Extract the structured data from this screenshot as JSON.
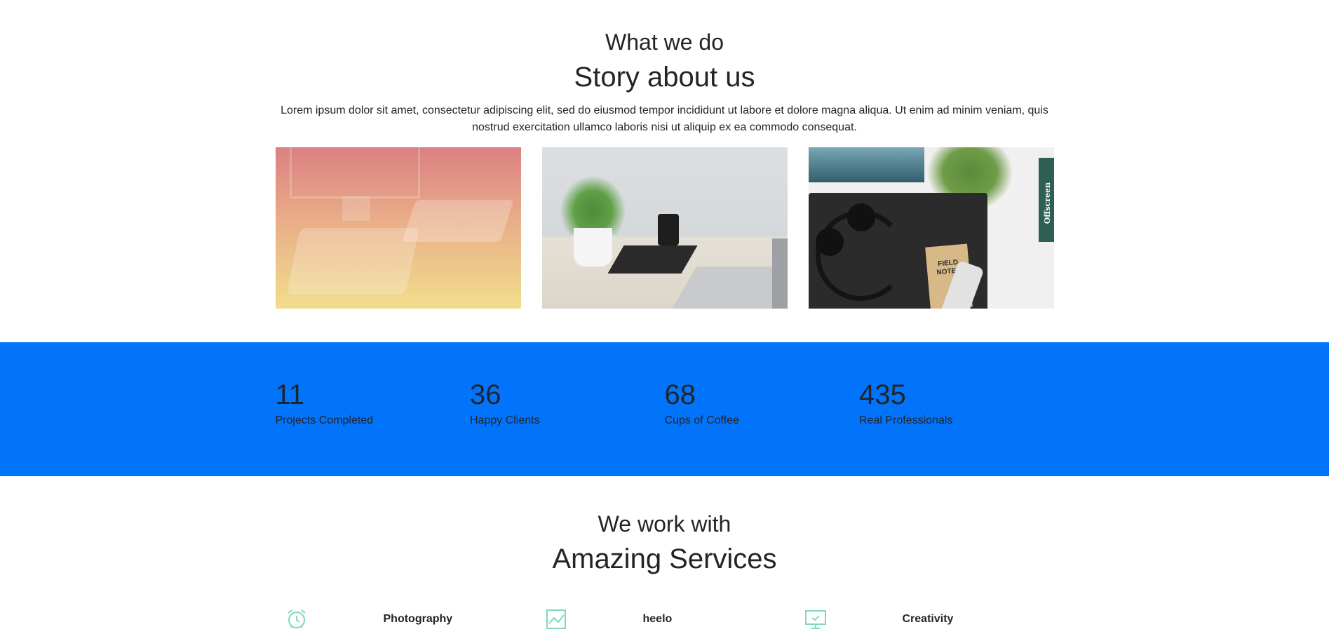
{
  "story": {
    "kicker": "What we do",
    "title": "Story about us",
    "lead": "Lorem ipsum dolor sit amet, consectetur adipiscing elit, sed do eiusmod tempor incididunt ut labore et dolore magna aliqua. Ut enim ad minim veniam, quis nostrud exercitation ullamco laboris nisi ut aliquip ex ea commodo consequat.",
    "photos": [
      {
        "name": "workspace-photo-gradient"
      },
      {
        "name": "workspace-photo-plant"
      },
      {
        "name": "workspace-photo-headphones",
        "notebook_text": "FIELD NOTES",
        "magazine_text": "Offscreen"
      }
    ]
  },
  "stats": {
    "background": "#0274fb",
    "items": [
      {
        "value": "11",
        "label": "Projects Completed"
      },
      {
        "value": "36",
        "label": "Happy Clients"
      },
      {
        "value": "68",
        "label": "Cups of Coffee"
      },
      {
        "value": "435",
        "label": "Real Professionals"
      }
    ]
  },
  "services": {
    "kicker": "We work with",
    "title": "Amazing Services",
    "icon_color": "#7fd8c0",
    "items": [
      {
        "icon": "alarm-clock-icon",
        "label": "Photography"
      },
      {
        "icon": "line-chart-icon",
        "label": "heelo"
      },
      {
        "icon": "monitor-icon",
        "label": "Creativity"
      }
    ]
  }
}
